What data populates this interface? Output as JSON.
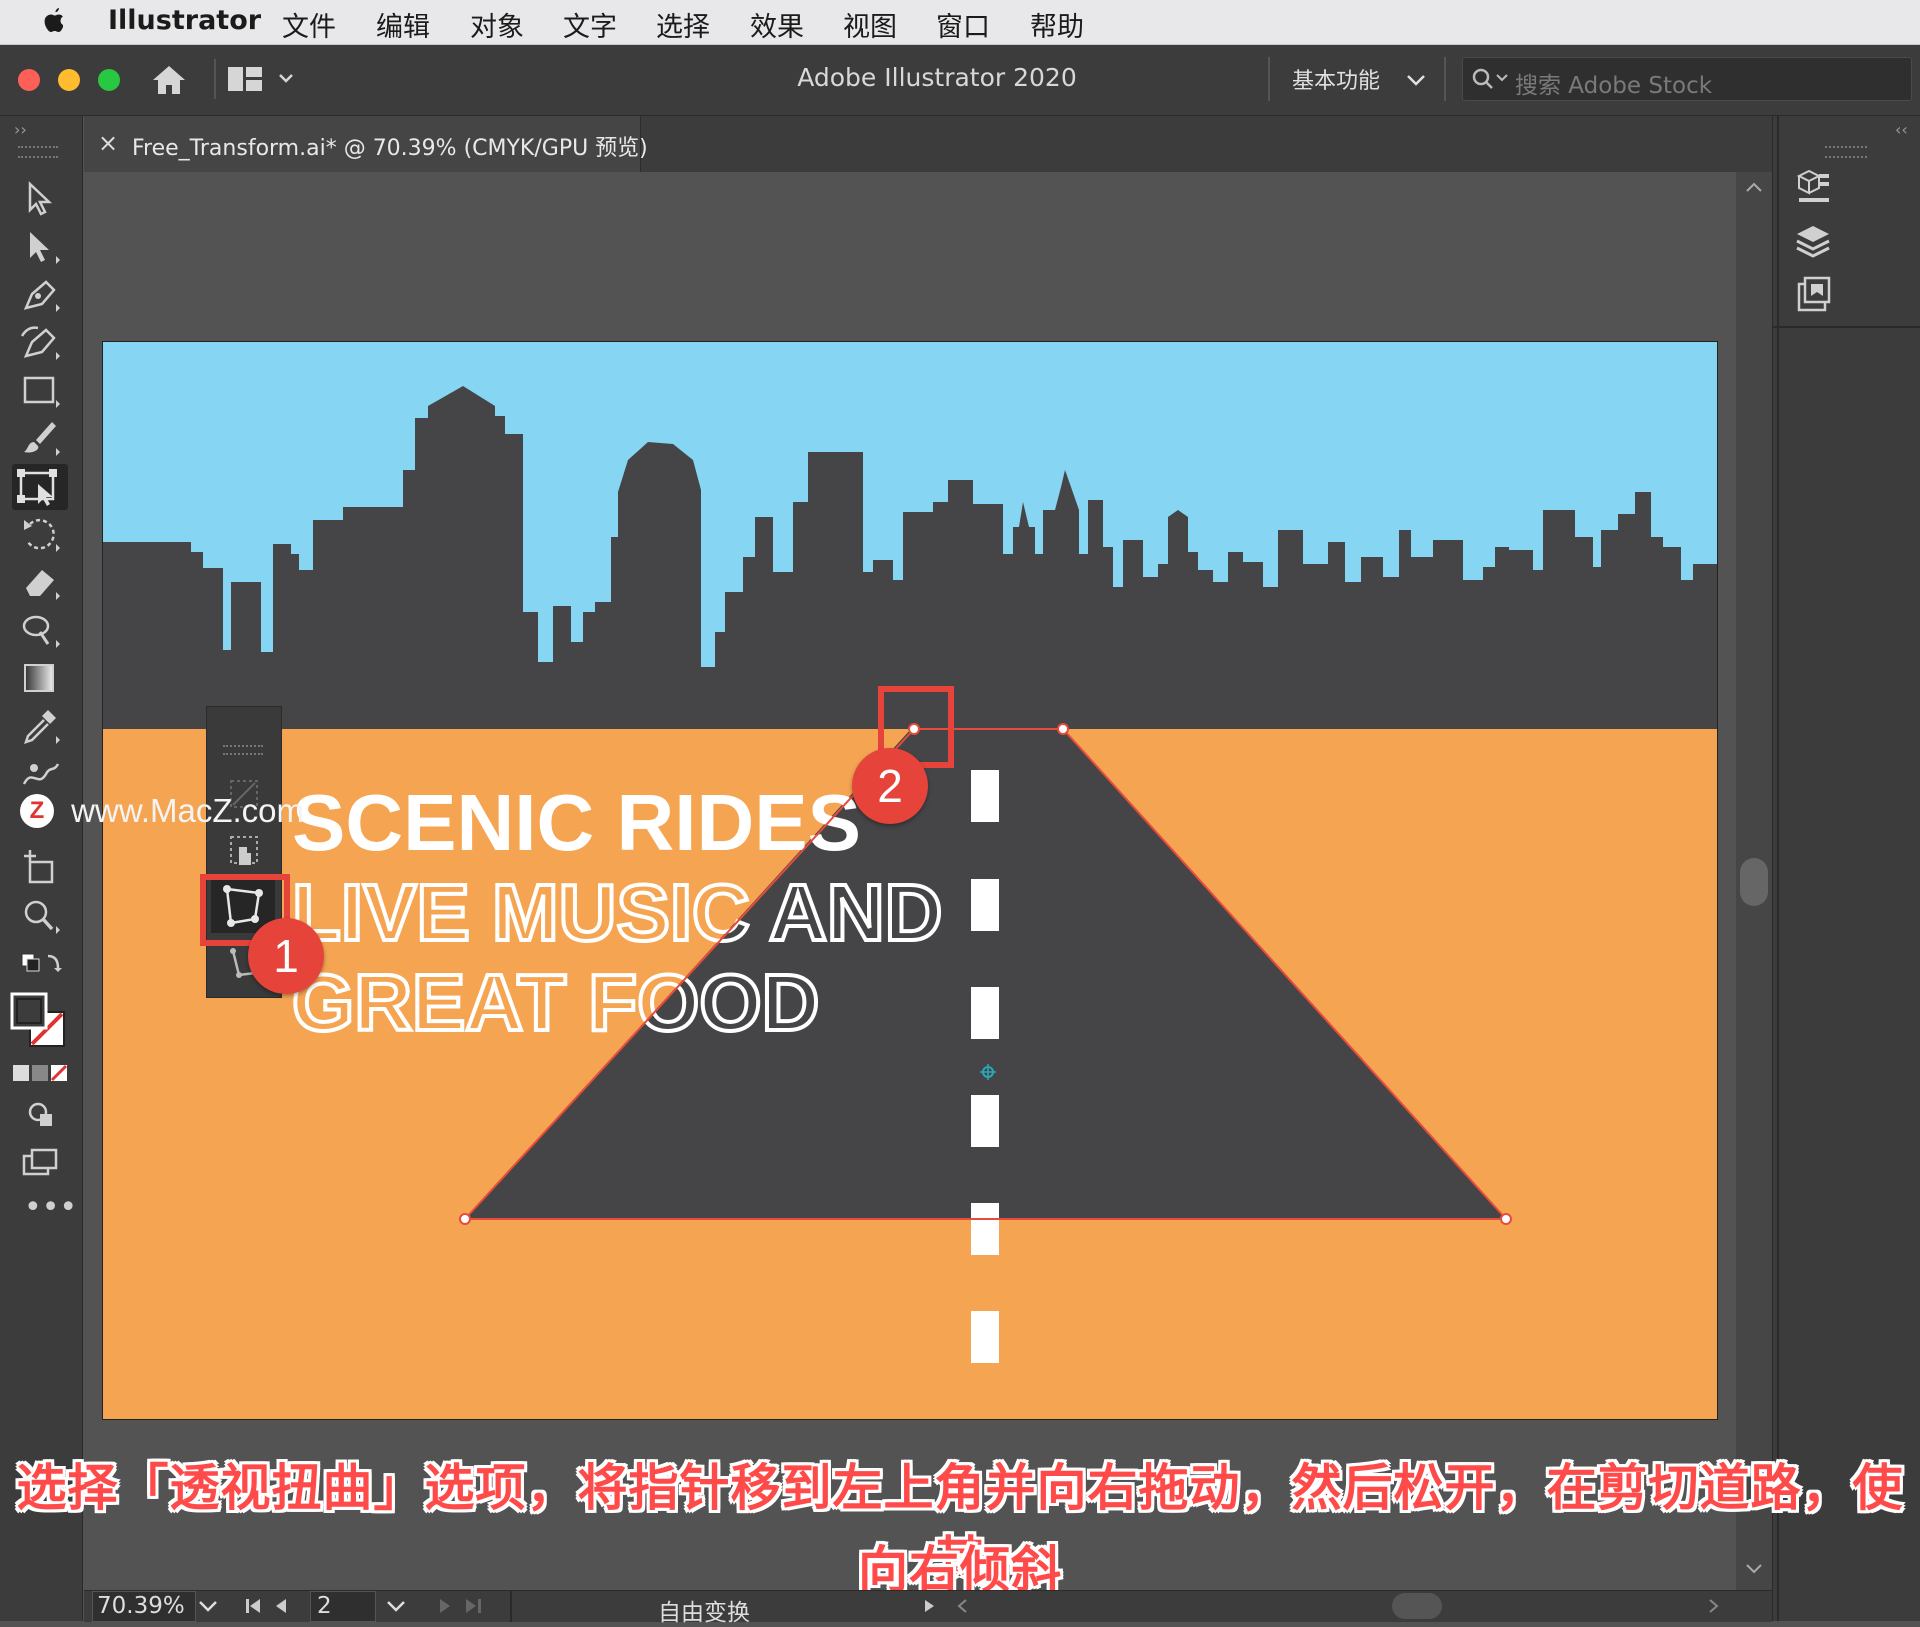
{
  "menubar": {
    "app_name": "Illustrator",
    "items": [
      "文件",
      "编辑",
      "对象",
      "文字",
      "选择",
      "效果",
      "视图",
      "窗口",
      "帮助"
    ]
  },
  "appbar": {
    "title": "Adobe Illustrator 2020",
    "workspace": "基本功能",
    "search_placeholder": "搜索 Adobe Stock"
  },
  "document": {
    "tab_label": "Free_Transform.ai* @ 70.39% (CMYK/GPU 预览)",
    "close_glyph": "×"
  },
  "artwork": {
    "line1": "SCENIC RIDES",
    "line2": "LIVE MUSIC AND",
    "line3": "GREAT FOOD",
    "colors": {
      "sky": "#86d5f2",
      "ground": "#f5a552",
      "city": "#454547",
      "road": "#454547",
      "selection": "#e64b3c"
    }
  },
  "callouts": {
    "one": "1",
    "two": "2"
  },
  "caption": {
    "line1": "选择「透视扭曲」选项，将指针移到左上角并向右拖动，然后松开，在剪切道路，使其",
    "line2": "向右倾斜"
  },
  "watermark": "www.MacZ.com",
  "status": {
    "zoom": "70.39%",
    "artboard": "2",
    "tool": "自由变换"
  },
  "icons": {
    "toolbar": [
      "selection-icon",
      "direct-selection-icon",
      "pen-icon",
      "curvature-icon",
      "rectangle-icon",
      "paintbrush-icon",
      "free-transform-icon",
      "rotate-icon",
      "eraser-icon",
      "lasso-icon",
      "gradient-icon",
      "eyedropper-icon",
      "puppet-warp-icon",
      "artboard-icon",
      "zoom-icon"
    ],
    "widget": [
      "constrain-icon",
      "free-transform-sub-icon",
      "perspective-distort-icon",
      "free-distort-icon"
    ],
    "right_panel": [
      "libraries-icon",
      "layers-icon",
      "artboards-panel-icon"
    ]
  }
}
